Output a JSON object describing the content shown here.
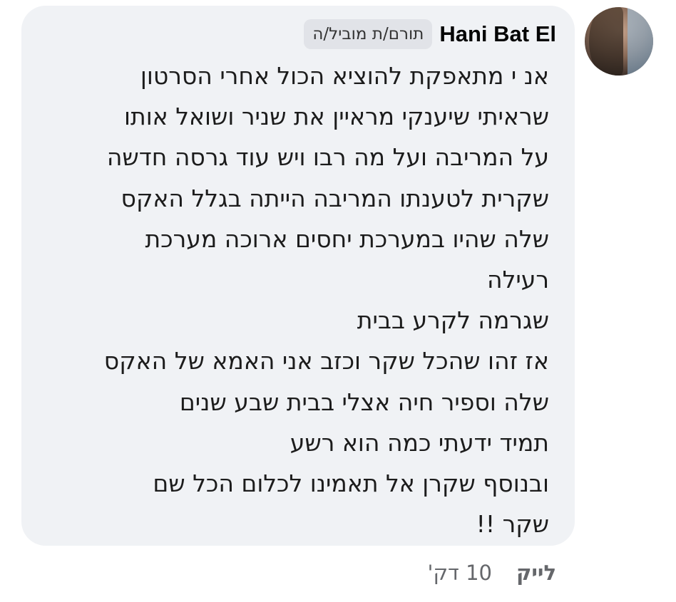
{
  "comment": {
    "author_name": "Hani Bat El",
    "author_badge": "תורם/ת מוביל/ה",
    "lines": [
      "אנ י מתאפקת  להוציא הכול  אחרי הסרטון",
      "שראיתי שיענקי מראיין את שניר  ושואל אותו",
      "על המריבה ועל מה רבו  ויש עוד גרסה חדשה",
      "שקרית  לטענתו המריבה הייתה בגלל האקס",
      "שלה שהיו במערכת יחסים ארוכה  מערכת",
      "רעילה",
      "שגרמה לקרע בבית",
      "אז זהו שהכל שקר וכזב  אני האמא של האקס",
      "שלה וספיר חיה אצלי בבית שבע שנים",
      "תמיד ידעתי כמה הוא רשע",
      "ובנוסף שקרן אל תאמינו לכלום  הכל שם",
      "שקר !!"
    ]
  },
  "footer": {
    "timestamp": "10 דק'",
    "like_label": "לייק"
  },
  "colors": {
    "bubble_background": "#f0f2f5",
    "badge_background": "#e1e3e8",
    "meta_text": "#65676b"
  }
}
